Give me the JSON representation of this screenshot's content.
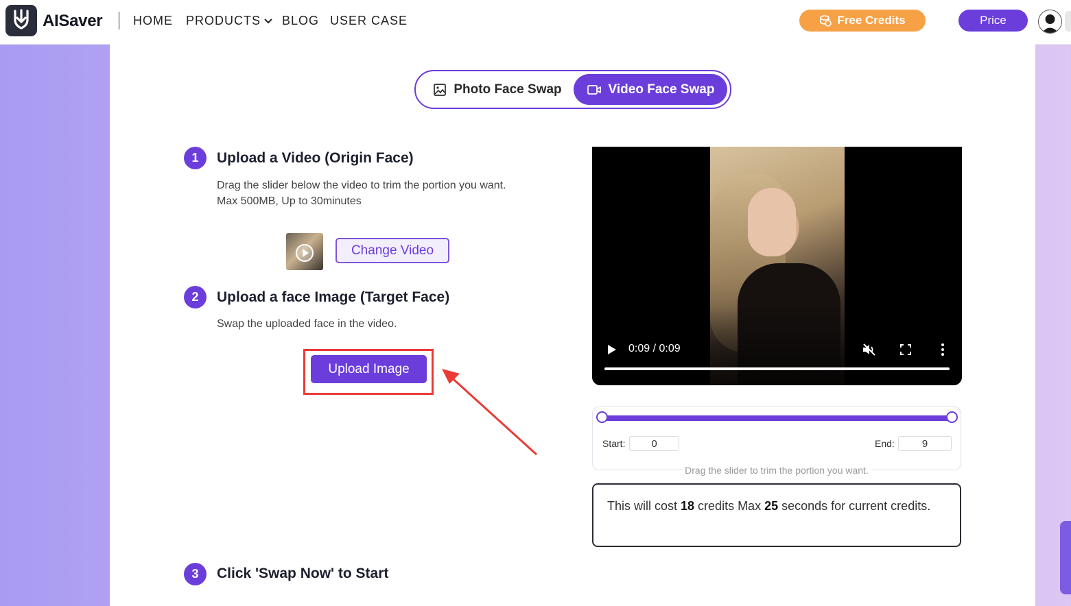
{
  "header": {
    "brand": "AISaver",
    "nav": [
      "HOME",
      "PRODUCTS",
      "BLOG",
      "USER CASE"
    ],
    "free_credits": "Free Credits",
    "price": "Price"
  },
  "tabs": {
    "photo": "Photo Face Swap",
    "video": "Video Face Swap"
  },
  "steps": [
    {
      "num": "1",
      "title": "Upload a Video (Origin Face)",
      "desc1": "Drag the slider below the video to trim the portion you want.",
      "desc2": "Max 500MB, Up to 30minutes"
    },
    {
      "num": "2",
      "title": "Upload a face Image (Target Face)",
      "desc1": "Swap the uploaded face in the video."
    },
    {
      "num": "3",
      "title": "Click 'Swap Now' to Start"
    }
  ],
  "buttons": {
    "change_video": "Change Video",
    "upload_image": "Upload Image"
  },
  "player": {
    "time": "0:09 / 0:09",
    "progress": 1.0
  },
  "trim": {
    "start_label": "Start:",
    "start_value": "0",
    "end_label": "End:",
    "end_value": "9",
    "hint": "Drag the slider to trim the portion you want."
  },
  "cost": {
    "prefix": "This will cost ",
    "credits": "18",
    "middle": " credits Max ",
    "seconds": "25",
    "suffix": " seconds for current credits."
  },
  "colors": {
    "accent": "#6b3ddb",
    "free_credits": "#f7a147",
    "highlight": "#ea3b36"
  }
}
